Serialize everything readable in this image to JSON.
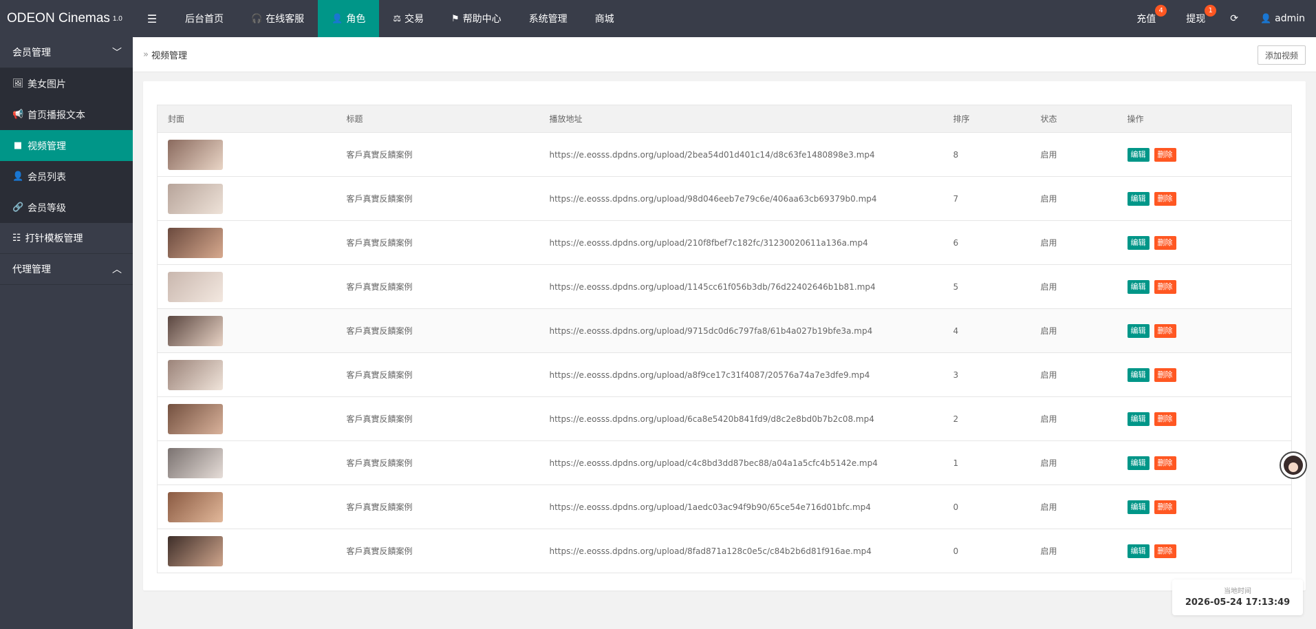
{
  "app": {
    "brand": "ODEON Cinemas",
    "version": "1.0"
  },
  "header": {
    "menu_toggle_icon": "hamburger-icon",
    "nav": [
      {
        "label": "后台首页",
        "icon": ""
      },
      {
        "label": "在线客服",
        "icon": "headset-icon"
      },
      {
        "label": "角色",
        "icon": "user-icon"
      },
      {
        "label": "交易",
        "icon": "scale-icon"
      },
      {
        "label": "帮助中心",
        "icon": "flag-icon"
      },
      {
        "label": "系统管理",
        "icon": ""
      },
      {
        "label": "商城",
        "icon": ""
      }
    ],
    "active_nav_index": 2,
    "recharge": {
      "label": "充值",
      "badge": "4"
    },
    "withdraw": {
      "label": "提现",
      "badge": "1"
    },
    "refresh_icon": "refresh-icon",
    "user": {
      "label": "admin"
    }
  },
  "sidebar": {
    "groups": [
      {
        "label": "会员管理",
        "expanded": true,
        "items": [
          {
            "label": "美女图片",
            "icon": "image-icon"
          },
          {
            "label": "首页播报文本",
            "icon": "megaphone-icon"
          },
          {
            "label": "视频管理",
            "icon": "video-icon"
          },
          {
            "label": "会员列表",
            "icon": "user-icon"
          },
          {
            "label": "会员等级",
            "icon": "link-icon"
          }
        ]
      },
      {
        "label": "打针模板管理",
        "icon": "list-icon"
      },
      {
        "label": "代理管理",
        "expanded": false
      }
    ],
    "active_item": "视频管理"
  },
  "breadcrumb": {
    "current": "视频管理"
  },
  "toolbar": {
    "add_label": "添加视频"
  },
  "table": {
    "headers": [
      "封面",
      "标题",
      "播放地址",
      "排序",
      "状态",
      "操作"
    ],
    "edit_label": "编辑",
    "delete_label": "删除",
    "rows": [
      {
        "title": "客戶真實反饋案例",
        "url": "https://e.eosss.dpdns.org/upload/2bea54d01d401c14/d8c63fe1480898e3.mp4",
        "sort": "8",
        "status": "启用"
      },
      {
        "title": "客戶真實反饋案例",
        "url": "https://e.eosss.dpdns.org/upload/98d046eeb7e79c6e/406aa63cb69379b0.mp4",
        "sort": "7",
        "status": "启用"
      },
      {
        "title": "客戶真實反饋案例",
        "url": "https://e.eosss.dpdns.org/upload/210f8fbef7c182fc/31230020611a136a.mp4",
        "sort": "6",
        "status": "启用"
      },
      {
        "title": "客戶真實反饋案例",
        "url": "https://e.eosss.dpdns.org/upload/1145cc61f056b3db/76d22402646b1b81.mp4",
        "sort": "5",
        "status": "启用"
      },
      {
        "title": "客戶真實反饋案例",
        "url": "https://e.eosss.dpdns.org/upload/9715dc0d6c797fa8/61b4a027b19bfe3a.mp4",
        "sort": "4",
        "status": "启用"
      },
      {
        "title": "客戶真實反饋案例",
        "url": "https://e.eosss.dpdns.org/upload/a8f9ce17c31f4087/20576a74a7e3dfe9.mp4",
        "sort": "3",
        "status": "启用"
      },
      {
        "title": "客戶真實反饋案例",
        "url": "https://e.eosss.dpdns.org/upload/6ca8e5420b841fd9/d8c2e8bd0b7b2c08.mp4",
        "sort": "2",
        "status": "启用"
      },
      {
        "title": "客戶真實反饋案例",
        "url": "https://e.eosss.dpdns.org/upload/c4c8bd3dd87bec88/a04a1a5cfc4b5142e.mp4",
        "sort": "1",
        "status": "启用"
      },
      {
        "title": "客戶真實反饋案例",
        "url": "https://e.eosss.dpdns.org/upload/1aedc03ac94f9b90/65ce54e716d01bfc.mp4",
        "sort": "0",
        "status": "启用"
      },
      {
        "title": "客戶真實反饋案例",
        "url": "https://e.eosss.dpdns.org/upload/8fad871a128c0e5c/c84b2b6d81f916ae.mp4",
        "sort": "0",
        "status": "启用"
      }
    ]
  },
  "clock": {
    "label": "当地时间",
    "value": "2026-05-24 17:13:49"
  },
  "colors": {
    "header_bg": "#393d49",
    "accent": "#009688",
    "danger": "#ff5722"
  }
}
